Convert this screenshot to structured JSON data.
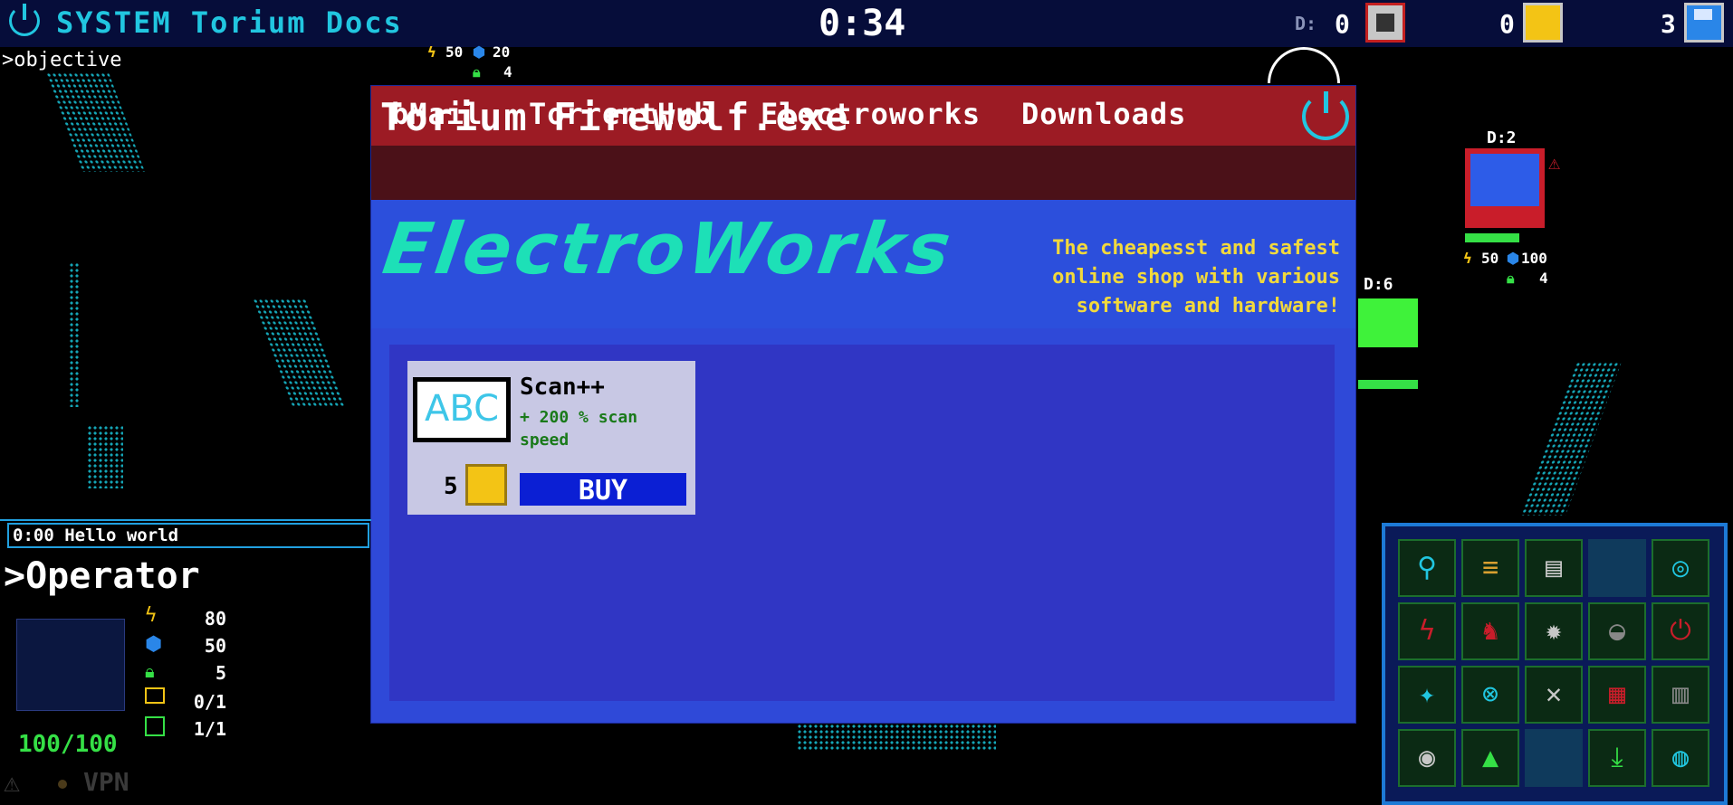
{
  "topbar": {
    "system_title": "SYSTEM Torium Docs",
    "timer": "0:34",
    "d_label": "D:",
    "chips": "0",
    "skulls": "0",
    "saves": "3"
  },
  "map": {
    "objective": ">objective",
    "router_stats": {
      "energy": "50",
      "shield": "20",
      "lock": "4"
    },
    "node2": {
      "label": "D:2",
      "energy": "50",
      "shield": "100",
      "lock": "4"
    },
    "node6": {
      "label": "D:6"
    }
  },
  "window": {
    "title": "Torium Firewolf.exe",
    "nav": [
      "bMail",
      "TorrentHub",
      "Electroworks",
      "Downloads"
    ],
    "site": {
      "logo": "ElectroWorks",
      "tagline_lines": [
        "The cheapesst and safest",
        "online shop with  various",
        "software and hardware!"
      ]
    },
    "product": {
      "image_text": "ABC",
      "name": "Scan++",
      "desc": "+ 200 % scan speed",
      "price": "5",
      "buy_label": "BUY"
    }
  },
  "log": {
    "entry": "0:00 Hello world"
  },
  "operator": {
    "title": ">Operator",
    "energy": "80",
    "shield": "50",
    "lock": "5",
    "terminals": "0/1",
    "x_slots": "1/1",
    "health": "100/100",
    "vpn": "VPN"
  },
  "toolbox": {
    "tools": [
      "search-icon",
      "tcp-icon",
      "cmd-panel-icon",
      "empty-slot",
      "scan-target-icon",
      "power-surge-icon",
      "chess-knight-icon",
      "mine-icon",
      "spy-icon",
      "power-icon",
      "network-star-icon",
      "target-x-icon",
      "wrench-icon",
      "log-delete-icon",
      "trash-icon",
      "disk-download-icon",
      "up-arrow-icon",
      "empty-slot",
      "download-icon",
      "fingerprint-icon"
    ]
  },
  "colors": {
    "accent": "#21c6e0",
    "window_bg": "#2f49d8",
    "title_red": "#9c1b24",
    "logo_green": "#1de0b7",
    "tagline_yellow": "#f2d93c"
  }
}
